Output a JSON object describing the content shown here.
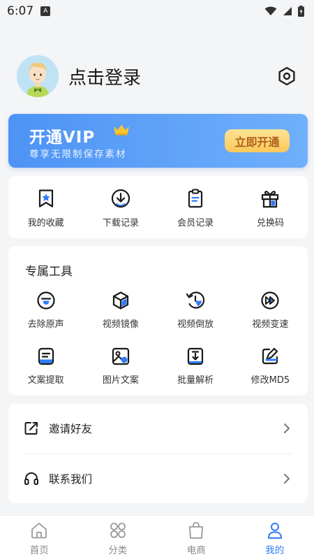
{
  "status_bar": {
    "time": "6:07",
    "notification_badge": "A"
  },
  "profile": {
    "login_text": "点击登录",
    "avatar_icon": "avatar-icon",
    "settings_icon": "settings-icon"
  },
  "vip": {
    "title": "开通VIP",
    "subtitle": "尊享无限制保存素材",
    "button_label": "立即开通",
    "crown_color": "#f7c531"
  },
  "quick_actions": [
    {
      "label": "我的收藏",
      "icon": "favorite-star-icon"
    },
    {
      "label": "下载记录",
      "icon": "download-icon"
    },
    {
      "label": "会员记录",
      "icon": "clipboard-icon"
    },
    {
      "label": "兑换码",
      "icon": "gift-icon"
    }
  ],
  "tools": {
    "title": "专属工具",
    "items": [
      {
        "label": "去除原声",
        "icon": "mute-circle-icon"
      },
      {
        "label": "视频镜像",
        "icon": "cube-icon"
      },
      {
        "label": "视频倒放",
        "icon": "rewind-icon"
      },
      {
        "label": "视频变速",
        "icon": "fast-forward-icon"
      },
      {
        "label": "文案提取",
        "icon": "text-extract-icon"
      },
      {
        "label": "图片文案",
        "icon": "image-icon"
      },
      {
        "label": "批量解析",
        "icon": "batch-download-icon"
      },
      {
        "label": "修改MD5",
        "icon": "edit-icon"
      }
    ]
  },
  "links": [
    {
      "label": "邀请好友",
      "icon": "share-icon"
    },
    {
      "label": "联系我们",
      "icon": "headset-icon"
    }
  ],
  "bottom_nav": [
    {
      "label": "首页",
      "icon": "home-icon",
      "active": false
    },
    {
      "label": "分类",
      "icon": "category-icon",
      "active": false
    },
    {
      "label": "电商",
      "icon": "shopping-bag-icon",
      "active": false
    },
    {
      "label": "我的",
      "icon": "profile-icon",
      "active": true
    }
  ],
  "colors": {
    "accent": "#2f7cf6",
    "vip_gradient_start": "#4d93f5",
    "vip_gradient_end": "#6fb0fb",
    "vip_button": "#f9c95a",
    "vip_button_text": "#b0601a",
    "background": "#f4f5f7"
  }
}
